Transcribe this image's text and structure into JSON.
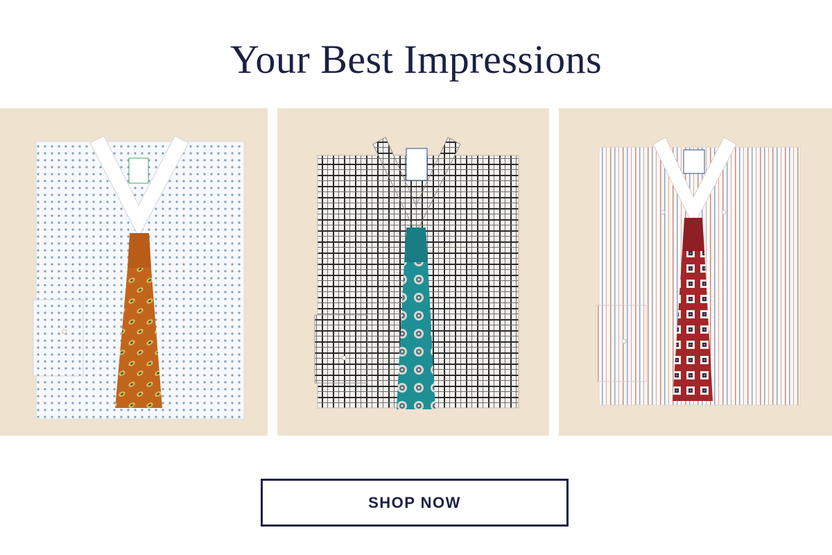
{
  "headline": "Your Best Impressions",
  "cta": {
    "label": "SHOP NOW"
  },
  "colors": {
    "navy": "#1b2044",
    "backdrop": "#efe3cf",
    "tie_orange": "#c2651c",
    "tie_teal": "#1f8f96",
    "tie_red": "#a3262a"
  },
  "products": [
    {
      "shirt": "white dot print dress shirt",
      "tie": "orange paisley tie",
      "label_icon": "green-collar-label"
    },
    {
      "shirt": "black and white check dress shirt",
      "tie": "teal medallion tie",
      "label_icon": "blue-collar-label"
    },
    {
      "shirt": "multi-stripe button-down dress shirt",
      "tie": "red geometric tie",
      "label_icon": "blue-collar-label"
    }
  ]
}
